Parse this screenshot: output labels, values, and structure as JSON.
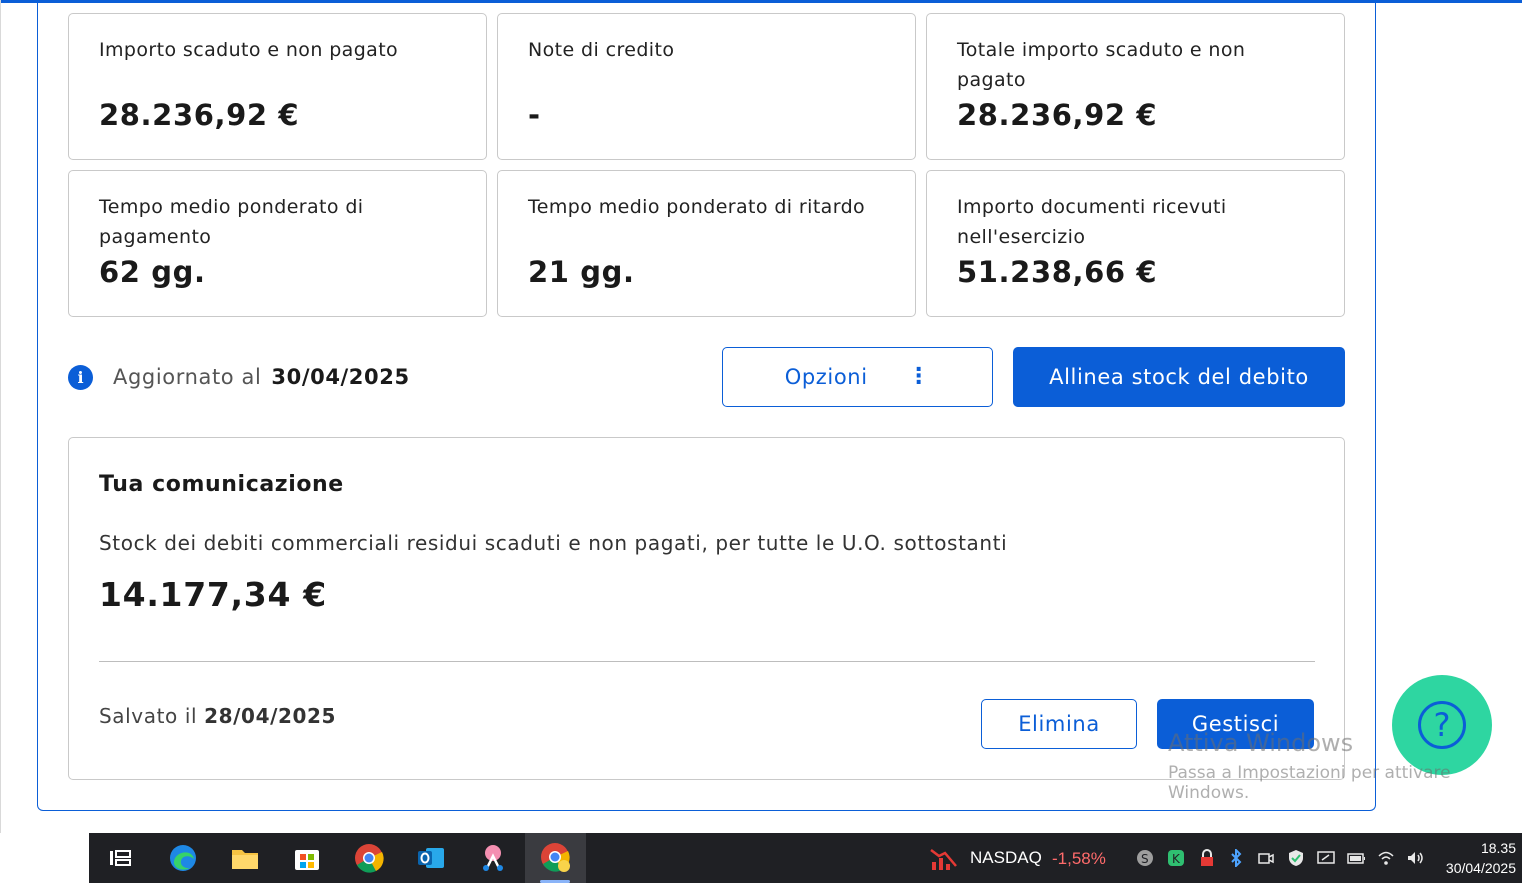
{
  "cards": [
    {
      "label": "Importo scaduto e non pagato",
      "value": "28.236,92 €"
    },
    {
      "label": "Note di credito",
      "value": "-"
    },
    {
      "label": "Totale importo scaduto e non pagato",
      "value": "28.236,92 €"
    },
    {
      "label": "Tempo medio ponderato di pagamento",
      "value": "62 gg."
    },
    {
      "label": "Tempo medio ponderato di ritardo",
      "value": "21 gg."
    },
    {
      "label": "Importo documenti ricevuti nell'esercizio",
      "value": "51.238,66 €"
    }
  ],
  "update": {
    "label": "Aggiornato al",
    "date": "30/04/2025"
  },
  "buttons": {
    "options": "Opzioni",
    "align": "Allinea stock del debito",
    "delete": "Elimina",
    "manage": "Gestisci"
  },
  "communication": {
    "title": "Tua comunicazione",
    "description": "Stock dei debiti commerciali residui scaduti e non pagati, per tutte le U.O. sottostanti",
    "value": "14.177,34 €",
    "saved_label": "Salvato il",
    "saved_date": "28/04/2025"
  },
  "help": {
    "icon": "question-icon",
    "glyph": "?"
  },
  "watermark": {
    "line1": "Attiva Windows",
    "line2": "Passa a Impostazioni per attivare Windows."
  },
  "taskbar": {
    "ticker_name": "NASDAQ",
    "ticker_change": "-1,58%",
    "time": "18.35",
    "date": "30/04/2025",
    "colors": {
      "ticker_negative": "#ff6b6b"
    }
  },
  "colors": {
    "accent": "#0b5ed7",
    "help_bg": "#2ed6a1"
  }
}
